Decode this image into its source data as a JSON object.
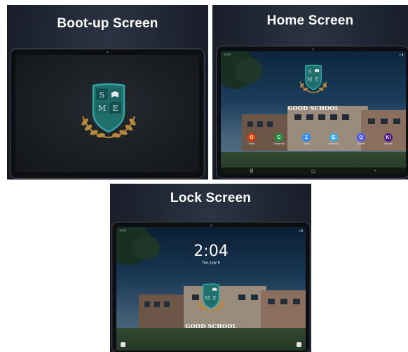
{
  "panels": {
    "boot": {
      "title": "Boot-up Screen"
    },
    "home": {
      "title": "Home Screen"
    },
    "lock": {
      "title": "Lock Screen"
    }
  },
  "crest": {
    "letters": {
      "top_left": "S",
      "bottom_left": "M",
      "bottom_right": "E"
    },
    "school_name": "GOOD SCHOOL",
    "colors": {
      "shield": "#1f6f6d",
      "shield_dark": "#14504f",
      "border": "#2fa3a0",
      "laurel": "#b98a3a"
    }
  },
  "home": {
    "status_time": "12:31",
    "apps": [
      {
        "name": "Office",
        "icon": "office-icon",
        "color": "#d83b01",
        "glyph": "O"
      },
      {
        "name": "Classroom",
        "icon": "classroom-icon",
        "color": "#1e8e3e",
        "glyph": "C"
      },
      {
        "name": "Zoom",
        "icon": "zoom-icon",
        "color": "#2d8cff",
        "glyph": "Z"
      },
      {
        "name": "Edmodo",
        "icon": "edmodo-icon",
        "color": "#3db0e6",
        "glyph": "E"
      },
      {
        "name": "Quizlet",
        "icon": "quizlet-icon",
        "color": "#4255ff",
        "glyph": "Q"
      },
      {
        "name": "Kahoot!",
        "icon": "kahoot-icon",
        "color": "#46178f",
        "glyph": "K!"
      }
    ],
    "nav": [
      "|||",
      "▢",
      "‹"
    ]
  },
  "lock": {
    "time": "2:04",
    "date": "Tue, July 6",
    "status_time": "12:31"
  }
}
